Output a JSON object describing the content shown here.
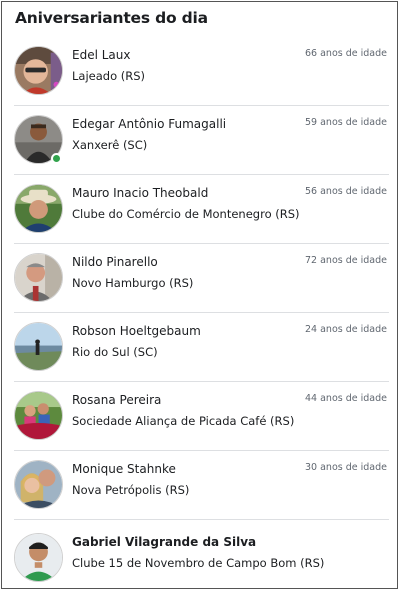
{
  "title": "Aniversariantes do dia",
  "people": [
    {
      "name": "Edel Laux",
      "place": "Lajeado (RS)",
      "age": "66 anos de idade",
      "avatar": "avatar-woman-glasses",
      "online": false
    },
    {
      "name": "Edegar Antônio Fumagalli",
      "place": "Xanxerê (SC)",
      "age": "59 anos de idade",
      "avatar": "avatar-man-dark",
      "online": true
    },
    {
      "name": "Mauro Inacio Theobald",
      "place": "Clube do Comércio de Montenegro  (RS)",
      "age": "56 anos de idade",
      "avatar": "avatar-man-hat",
      "online": false
    },
    {
      "name": "Nildo Pinarello",
      "place": "Novo Hamburgo (RS)",
      "age": "72 anos de idade",
      "avatar": "avatar-man-older",
      "online": false
    },
    {
      "name": "Robson Hoeltgebaum",
      "place": "Rio do Sul (SC)",
      "age": "24 anos de idade",
      "avatar": "avatar-landscape",
      "online": false
    },
    {
      "name": "Rosana Pereira",
      "place": "Sociedade Aliança de Picada Café (RS)",
      "age": "44 anos de idade",
      "avatar": "avatar-family",
      "online": false
    },
    {
      "name": "Monique Stahnke",
      "place": "Nova Petrópolis (RS)",
      "age": "30 anos de idade",
      "avatar": "avatar-couple",
      "online": false
    },
    {
      "name": "Gabriel Vilagrande da Silva",
      "place": "Clube 15 de Novembro  de Campo Bom (RS)",
      "age": "",
      "avatar": "avatar-young-man",
      "online": false
    }
  ]
}
